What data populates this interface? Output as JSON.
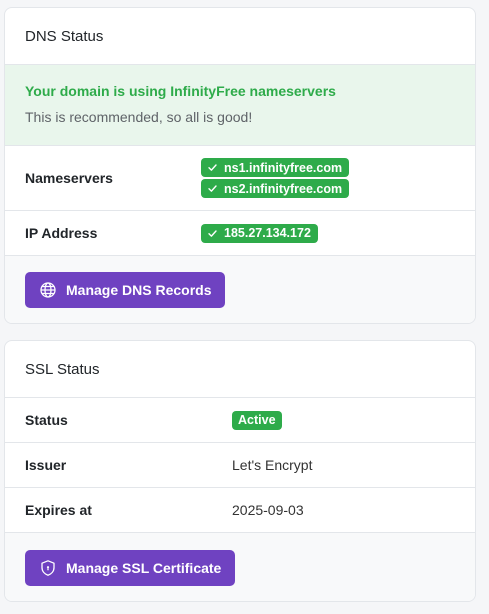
{
  "dns": {
    "title": "DNS Status",
    "alert_title": "Your domain is using InfinityFree nameservers",
    "alert_text": "This is recommended, so all is good!",
    "nameservers_label": "Nameservers",
    "nameservers": [
      "ns1.infinityfree.com",
      "ns2.infinityfree.com"
    ],
    "ip_label": "IP Address",
    "ip": "185.27.134.172",
    "manage_button": "Manage DNS Records"
  },
  "ssl": {
    "title": "SSL Status",
    "status_label": "Status",
    "status": "Active",
    "issuer_label": "Issuer",
    "issuer": "Let's Encrypt",
    "expires_label": "Expires at",
    "expires": "2025-09-03",
    "manage_button": "Manage SSL Certificate"
  },
  "colors": {
    "success": "#2eab4a",
    "primary": "#6f42c1",
    "alert_bg": "#e9f6ec"
  },
  "icons": {
    "check": "check-icon",
    "globe": "globe-icon",
    "shield": "shield-icon"
  }
}
